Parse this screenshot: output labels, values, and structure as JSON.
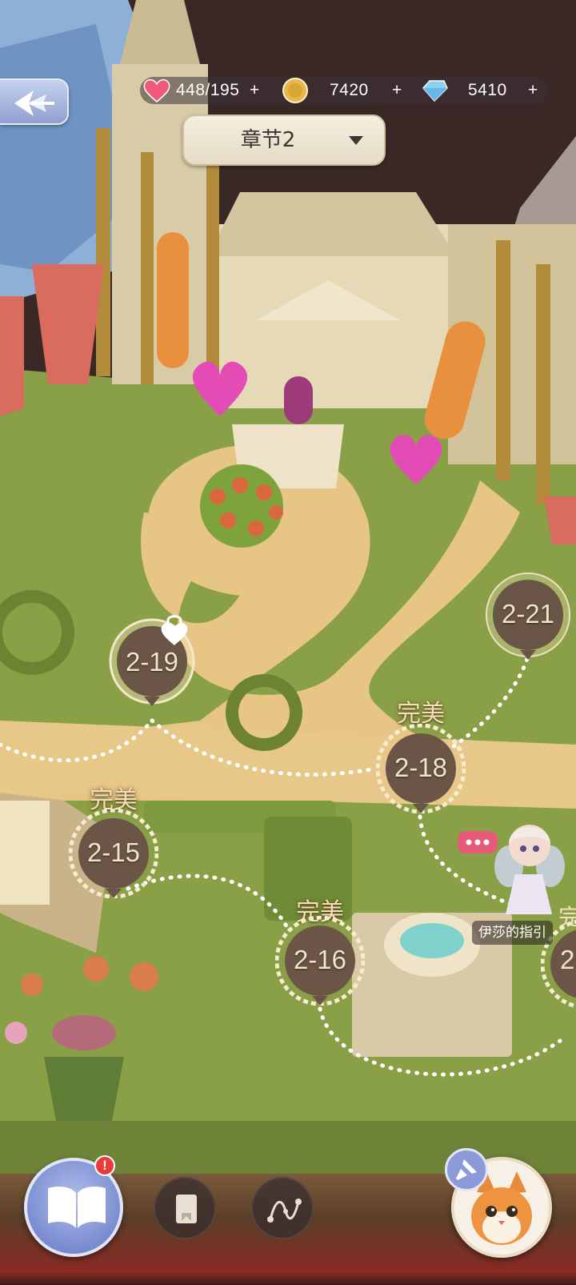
{
  "resources": {
    "stamina": {
      "value": "448/195",
      "plus": "+",
      "icon": "heart-icon"
    },
    "coins": {
      "value": "7420",
      "plus": "+",
      "icon": "coin-icon"
    },
    "diamonds": {
      "value": "5410",
      "plus": "+",
      "icon": "diamond-icon"
    }
  },
  "header": {
    "back_icon": "back-arrow-icon",
    "chapter_label": "章节2",
    "chapter_dropdown_icon": "caret-down-icon"
  },
  "levels": [
    {
      "id": "2-19",
      "grade": "",
      "state": "locked",
      "icon": "heart-lock-icon"
    },
    {
      "id": "2-21",
      "grade": "",
      "state": "available"
    },
    {
      "id": "2-18",
      "grade": "完美",
      "state": "perfect"
    },
    {
      "id": "2-15",
      "grade": "完美",
      "state": "perfect"
    },
    {
      "id": "2-16",
      "grade": "完美",
      "state": "perfect"
    },
    {
      "id": "2",
      "grade": "完",
      "state": "perfect"
    }
  ],
  "guide": {
    "name": "伊莎的指引",
    "bubble_icon": "chat-bubble-icon"
  },
  "bottom_bar": {
    "story_book_icon": "open-book-icon",
    "story_book_badge": "!",
    "card_icon": "bookmark-card-icon",
    "route_icon": "route-path-icon",
    "pin_icon": "pushpin-icon",
    "pet_icon": "cat-avatar-icon"
  },
  "colors": {
    "grass": "#8fa24a",
    "path": "#e7c585",
    "node_fill": "#6a5547",
    "node_text": "#f3e4c3",
    "accent_blue": "#8c9ad8",
    "badge_red": "#e83b3b"
  }
}
